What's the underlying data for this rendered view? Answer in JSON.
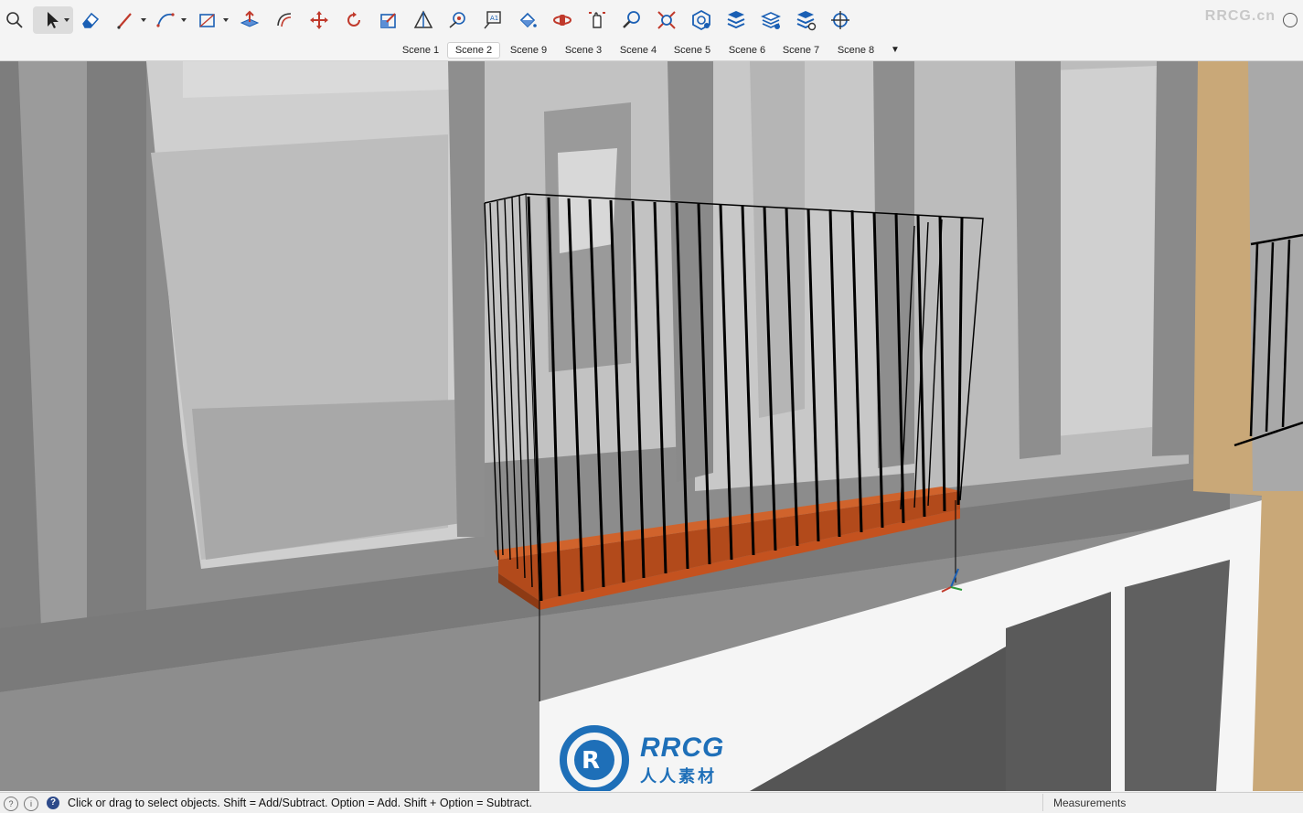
{
  "toolbar": {
    "tools": [
      "search-icon",
      "select-icon",
      "eraser-icon",
      "pencil-icon",
      "arc-icon",
      "rectangle-icon",
      "push-pull-icon",
      "offset-icon",
      "move-icon",
      "rotate-icon",
      "scale-icon",
      "section-icon",
      "tape-measure-icon",
      "text-icon",
      "paint-bucket-icon",
      "orbit-icon",
      "pan-icon",
      "zoom-icon",
      "zoom-extents-icon",
      "components-icon",
      "tags-icon",
      "layers-icon",
      "styles-icon",
      "position-camera-icon"
    ],
    "brand": "RRCG.cn"
  },
  "scenes": {
    "tabs": [
      "Scene 1",
      "Scene 2",
      "Scene 9",
      "Scene 3",
      "Scene 4",
      "Scene 5",
      "Scene 6",
      "Scene 7",
      "Scene 8"
    ],
    "active": "Scene 2",
    "more": "▼"
  },
  "status": {
    "icon1": "?",
    "icon2": "i",
    "help": "?",
    "message": "Click or drag to select objects. Shift = Add/Subtract. Option = Add. Shift + Option = Subtract.",
    "measurements_label": "Measurements"
  },
  "logo": {
    "text": "RRCG",
    "subtitle": "人人素材"
  },
  "colors": {
    "planter": "#c4521f",
    "accent_wood": "#c9a878",
    "logo_blue": "#1e6fb8"
  }
}
